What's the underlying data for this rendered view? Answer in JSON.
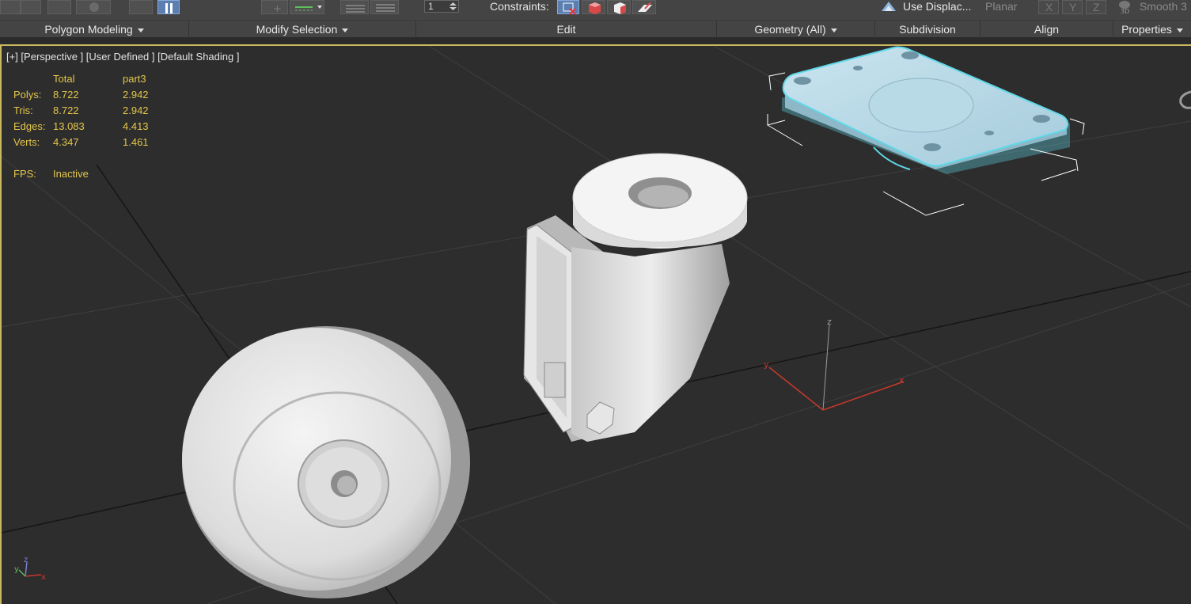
{
  "ribbon": {
    "spinner_value": "1",
    "constraints_label": "Constraints:",
    "use_displacement": "Use Displac...",
    "planar": "Planar",
    "axis_x": "X",
    "axis_y": "Y",
    "axis_z": "Z",
    "smooth": "Smooth 3",
    "groups": {
      "polygon_modeling": "Polygon Modeling",
      "modify_selection": "Modify Selection",
      "edit": "Edit",
      "geometry_all": "Geometry (All)",
      "subdivision": "Subdivision",
      "align": "Align",
      "properties": "Properties"
    }
  },
  "viewport": {
    "label": "[+] [Perspective ] [User Defined ] [Default Shading ]",
    "stats": {
      "col_total": "Total",
      "col_part": "part3",
      "rows": [
        {
          "label": "Polys:",
          "total": "8.722",
          "part": "2.942"
        },
        {
          "label": "Tris:",
          "total": "8.722",
          "part": "2.942"
        },
        {
          "label": "Edges:",
          "total": "13.083",
          "part": "4.413"
        },
        {
          "label": "Verts:",
          "total": "4.347",
          "part": "1.461"
        }
      ],
      "fps_label": "FPS:",
      "fps_value": "Inactive"
    },
    "gizmo": {
      "x": "x",
      "y": "y",
      "z": "z"
    },
    "axis_tripod": {
      "x": "x",
      "y": "y",
      "z": "z"
    }
  },
  "colors": {
    "viewport_border": "#c9b860",
    "stats_text": "#e3c64a",
    "selection_outline": "#5fd8e8"
  }
}
